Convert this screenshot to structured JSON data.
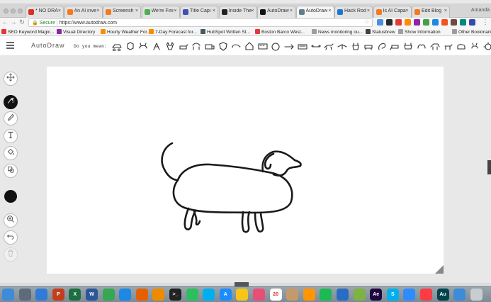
{
  "browser": {
    "profile": "Amanda",
    "tabs": [
      {
        "title": "* NO DRA",
        "color": "#d93025",
        "active": false
      },
      {
        "title": "An AI inve",
        "color": "#f4791f",
        "active": false
      },
      {
        "title": "Screensh",
        "color": "#f4791f",
        "active": false
      },
      {
        "title": "We're Fini",
        "color": "#4caf50",
        "active": false
      },
      {
        "title": "Title Capi",
        "color": "#3f51b5",
        "active": false
      },
      {
        "title": "Inside The",
        "color": "#222222",
        "active": false
      },
      {
        "title": "AutoDraw",
        "color": "#111111",
        "active": false
      },
      {
        "title": "AutoDraw",
        "color": "#607d8b",
        "active": true
      },
      {
        "title": "Hack Rod",
        "color": "#1976d2",
        "active": false
      },
      {
        "title": "Is AI Capa",
        "color": "#f4791f",
        "active": false
      },
      {
        "title": "Edit Blog",
        "color": "#f4791f",
        "active": false
      }
    ],
    "secure_label": "Secure",
    "url": "https://www.autodraw.com",
    "bookmarks": [
      {
        "label": "SEO Keyword Magic...",
        "color": "#e53935"
      },
      {
        "label": "Visual Directory",
        "color": "#8e24aa"
      },
      {
        "label": "Hourly Weather For...",
        "color": "#fb8c00"
      },
      {
        "label": "7-Day Forecast for...",
        "color": "#fb8c00"
      },
      {
        "label": "HubSpot Written St...",
        "color": "#455a64"
      },
      {
        "label": "Boston Barco West...",
        "color": "#e53935"
      },
      {
        "label": "News monitoring ou...",
        "color": "#9e9e9e"
      },
      {
        "label": "Statusbrew",
        "color": "#424242"
      },
      {
        "label": "Show Information",
        "color": "#9e9e9e"
      },
      {
        "label": "Other Bookmarks",
        "color": "#9e9e9e"
      }
    ]
  },
  "app": {
    "title": "AutoDraw",
    "suggest_label": "Do you mean:",
    "suggestion_icons": [
      "car-icon",
      "dog-face-icon",
      "cat-icon",
      "bird-icon",
      "moose-icon",
      "dog-icon",
      "horse-icon",
      "truck-icon",
      "shield-icon",
      "mouse-icon",
      "house-icon",
      "bus-icon",
      "ball-icon",
      "arrow-icon",
      "rug-icon",
      "bone-icon",
      "dog-running-icon",
      "bird-flying-icon",
      "deer-icon",
      "cow-icon",
      "squirrel-icon",
      "elephant-icon",
      "moose-2-icon",
      "camel-icon",
      "horse-2-icon",
      "dog-2-icon",
      "pig-icon",
      "cat-2-icon",
      "lion-icon"
    ],
    "tools": [
      {
        "name": "move-tool",
        "icon": "move-icon",
        "selected": false,
        "disabled": false
      },
      {
        "name": "autodraw-tool",
        "icon": "autodraw-icon",
        "selected": true,
        "disabled": false
      },
      {
        "name": "draw-tool",
        "icon": "pencil-icon",
        "selected": false,
        "disabled": false
      },
      {
        "name": "type-tool",
        "icon": "text-icon",
        "selected": false,
        "disabled": false
      },
      {
        "name": "fill-tool",
        "icon": "fill-icon",
        "selected": false,
        "disabled": false
      },
      {
        "name": "shape-tool",
        "icon": "shape-icon",
        "selected": false,
        "disabled": false
      }
    ],
    "bottom_tools": [
      {
        "name": "zoom-tool",
        "icon": "zoom-icon",
        "disabled": false
      },
      {
        "name": "undo-tool",
        "icon": "undo-icon",
        "disabled": false
      },
      {
        "name": "delete-tool",
        "icon": "trash-icon",
        "disabled": true
      }
    ],
    "current_color": "#111111",
    "drawing_subject": "dog-sketch"
  },
  "dock": [
    {
      "name": "finder-icon",
      "color": "#3d8bd9",
      "glyph": ""
    },
    {
      "name": "launchpad-icon",
      "color": "#5e6b7a",
      "glyph": ""
    },
    {
      "name": "safari-icon",
      "color": "#2f7bd6",
      "glyph": ""
    },
    {
      "name": "powerpoint-icon",
      "color": "#c43e1c",
      "glyph": "P"
    },
    {
      "name": "excel-icon",
      "color": "#1d6f42",
      "glyph": "X"
    },
    {
      "name": "word-icon",
      "color": "#2b579a",
      "glyph": "W"
    },
    {
      "name": "chrome-icon",
      "color": "#34a853",
      "glyph": ""
    },
    {
      "name": "safari-2-icon",
      "color": "#1e88e5",
      "glyph": ""
    },
    {
      "name": "firefox-icon",
      "color": "#e66000",
      "glyph": ""
    },
    {
      "name": "vlc-icon",
      "color": "#f08a00",
      "glyph": ""
    },
    {
      "name": "terminal-icon",
      "color": "#222222",
      "glyph": ">_"
    },
    {
      "name": "evernote-icon",
      "color": "#2dbe60",
      "glyph": ""
    },
    {
      "name": "skype-icon",
      "color": "#00aff0",
      "glyph": ""
    },
    {
      "name": "app-store-icon",
      "color": "#1a8cff",
      "glyph": "A"
    },
    {
      "name": "photos-icon",
      "color": "#f5c518",
      "glyph": ""
    },
    {
      "name": "itunes-icon",
      "color": "#e94e77",
      "glyph": ""
    },
    {
      "name": "calendar-icon",
      "color": "#ffffff",
      "glyph": "20"
    },
    {
      "name": "contacts-icon",
      "color": "#c49a6c",
      "glyph": ""
    },
    {
      "name": "ibooks-icon",
      "color": "#ff9500",
      "glyph": ""
    },
    {
      "name": "spotify-icon",
      "color": "#1db954",
      "glyph": ""
    },
    {
      "name": "network-icon",
      "color": "#2a6cc4",
      "glyph": ""
    },
    {
      "name": "android-icon",
      "color": "#7cb342",
      "glyph": ""
    },
    {
      "name": "after-effects-icon",
      "color": "#1f0740",
      "glyph": "Ae"
    },
    {
      "name": "skype-2-icon",
      "color": "#00aff0",
      "glyph": "S"
    },
    {
      "name": "zoom-icon",
      "color": "#2d8cff",
      "glyph": ""
    },
    {
      "name": "music-icon",
      "color": "#fc3c44",
      "glyph": ""
    },
    {
      "name": "audition-icon",
      "color": "#00434c",
      "glyph": "Au"
    },
    {
      "name": "finder-2-icon",
      "color": "#3d8bd9",
      "glyph": ""
    },
    {
      "name": "trash-icon",
      "color": "#c8cdd1",
      "glyph": ""
    }
  ]
}
